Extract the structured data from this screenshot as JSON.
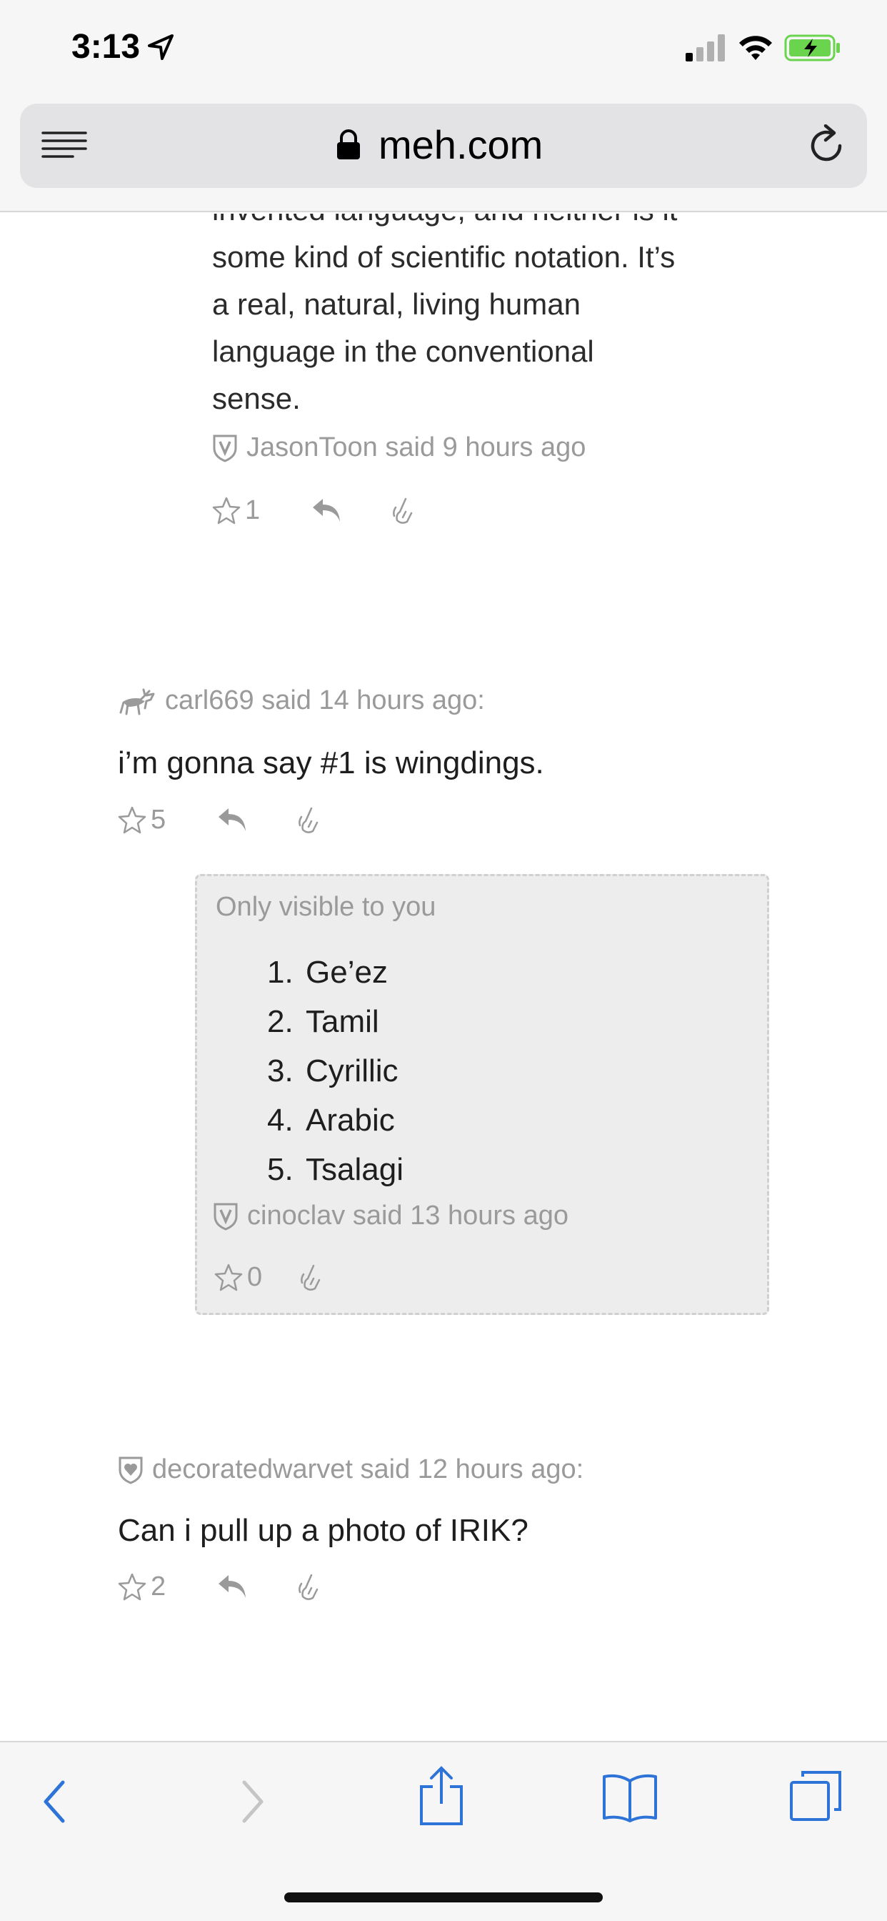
{
  "status_bar": {
    "time": "3:13",
    "colors": {
      "battery": "#6bd44e"
    }
  },
  "browser": {
    "url": "meh.com"
  },
  "comments": [
    {
      "continued_text": [
        "invented language, and neither is it",
        "some kind of scientific notation. It’s",
        "a real, natural, living human",
        "language in the conventional",
        "sense."
      ],
      "author": "JasonToon",
      "time": "said 9 hours ago",
      "stars": "1"
    },
    {
      "author": "carl669",
      "time": "said 14 hours ago:",
      "body": "i’m gonna say #1 is wingdings.",
      "stars": "5"
    },
    {
      "private_label": "Only visible to you",
      "list": [
        {
          "num": "1.",
          "text": "Ge’ez"
        },
        {
          "num": "2.",
          "text": "Tamil"
        },
        {
          "num": "3.",
          "text": "Cyrillic"
        },
        {
          "num": "4.",
          "text": "Arabic"
        },
        {
          "num": "5.",
          "text": "Tsalagi"
        }
      ],
      "author": "cinoclav",
      "time": "said 13 hours ago",
      "stars": "0"
    },
    {
      "author": "decoratedwarvet",
      "time": "said 12 hours ago:",
      "body": "Can i pull up a photo of IRIK?",
      "stars": "2"
    }
  ],
  "colors": {
    "toolbar_blue": "#2e73d8",
    "meta_gray": "#9a9a9a"
  }
}
